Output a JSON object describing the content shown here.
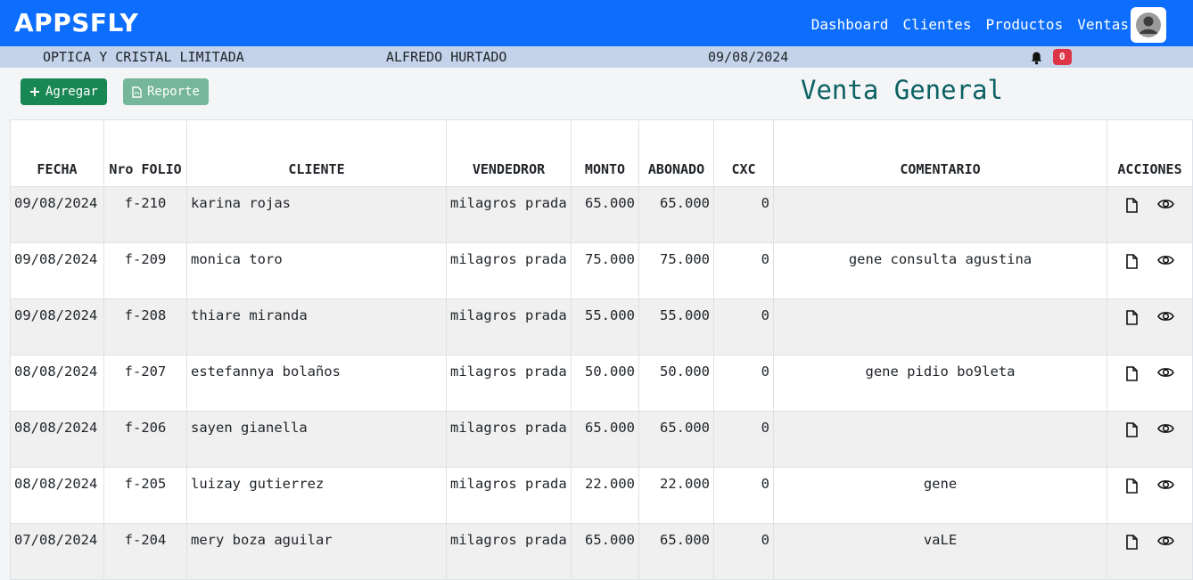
{
  "header": {
    "brand": "APPSFLY",
    "nav": [
      "Dashboard",
      "Clientes",
      "Productos",
      "Ventas"
    ]
  },
  "info": {
    "company": "OPTICA Y CRISTAL LIMITADA",
    "user": "ALFREDO HURTADO",
    "date": "09/08/2024",
    "notifications": "0"
  },
  "toolbar": {
    "add_label": "Agregar",
    "report_label": "Reporte"
  },
  "page_title": "Venta General",
  "table": {
    "columns": [
      "FECHA",
      "Nro FOLIO",
      "CLIENTE",
      "VENDEDROR",
      "MONTO",
      "ABONADO",
      "CXC",
      "COMENTARIO",
      "ACCIONES"
    ],
    "rows": [
      {
        "fecha": "09/08/2024",
        "folio": "f-210",
        "cliente": "karina rojas",
        "vendedor": "milagros prada",
        "monto": "65.000",
        "abonado": "65.000",
        "cxc": "0",
        "comentario": ""
      },
      {
        "fecha": "09/08/2024",
        "folio": "f-209",
        "cliente": "monica toro",
        "vendedor": "milagros prada",
        "monto": "75.000",
        "abonado": "75.000",
        "cxc": "0",
        "comentario": "gene consulta agustina"
      },
      {
        "fecha": "09/08/2024",
        "folio": "f-208",
        "cliente": "thiare miranda",
        "vendedor": "milagros prada",
        "monto": "55.000",
        "abonado": "55.000",
        "cxc": "0",
        "comentario": ""
      },
      {
        "fecha": "08/08/2024",
        "folio": "f-207",
        "cliente": "estefannya bolaños",
        "vendedor": "milagros prada",
        "monto": "50.000",
        "abonado": "50.000",
        "cxc": "0",
        "comentario": "gene pidio bo9leta"
      },
      {
        "fecha": "08/08/2024",
        "folio": "f-206",
        "cliente": "sayen gianella",
        "vendedor": "milagros prada",
        "monto": "65.000",
        "abonado": "65.000",
        "cxc": "0",
        "comentario": ""
      },
      {
        "fecha": "08/08/2024",
        "folio": "f-205",
        "cliente": "luizay gutierrez",
        "vendedor": "milagros prada",
        "monto": "22.000",
        "abonado": "22.000",
        "cxc": "0",
        "comentario": "gene"
      },
      {
        "fecha": "07/08/2024",
        "folio": "f-204",
        "cliente": "mery boza aguilar",
        "vendedor": "milagros prada",
        "monto": "65.000",
        "abonado": "65.000",
        "cxc": "0",
        "comentario": "vaLE"
      }
    ],
    "row_icons": [
      "document-icon",
      "eye-icon"
    ]
  },
  "colors": {
    "primary": "#0d6efd",
    "info_bar": "#c4d3ea",
    "add_button": "#198754",
    "report_button": "#75b798",
    "title": "#0c6163",
    "badge": "#dc3545"
  }
}
